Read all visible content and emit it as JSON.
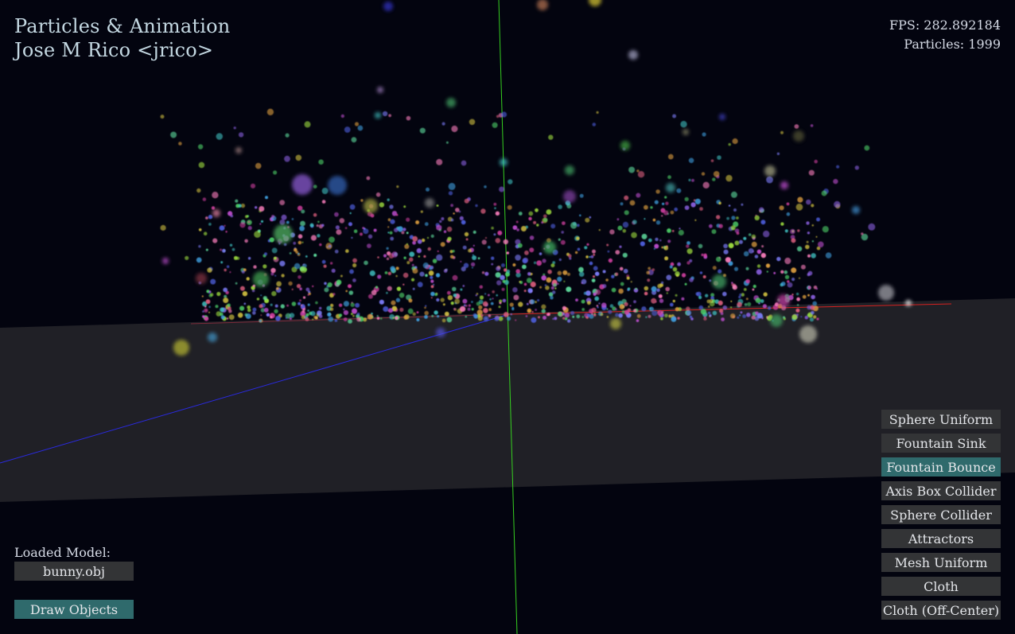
{
  "header": {
    "title": "Particles & Animation",
    "author": "Jose M Rico <jrico>"
  },
  "stats": {
    "fps": "FPS: 282.892184",
    "particles": "Particles: 1999"
  },
  "model": {
    "label": "Loaded Model:",
    "file": "bunny.obj"
  },
  "draw_objects": {
    "label": "Draw Objects",
    "active": true
  },
  "scenes": [
    {
      "label": "Sphere Uniform",
      "active": false
    },
    {
      "label": "Fountain Sink",
      "active": false
    },
    {
      "label": "Fountain Bounce",
      "active": true
    },
    {
      "label": "Axis Box Collider",
      "active": false
    },
    {
      "label": "Sphere Collider",
      "active": false
    },
    {
      "label": "Attractors",
      "active": false
    },
    {
      "label": "Mesh Uniform",
      "active": false
    },
    {
      "label": "Cloth",
      "active": false
    },
    {
      "label": "Cloth (Off-Center)",
      "active": false
    }
  ],
  "colors": {
    "background": "#03040f",
    "ground": "#202026",
    "x_axis": "#d02020",
    "y_axis": "#30d020",
    "z_axis": "#2030e0",
    "button": "#333436",
    "button_active": "#2f6a6c"
  }
}
